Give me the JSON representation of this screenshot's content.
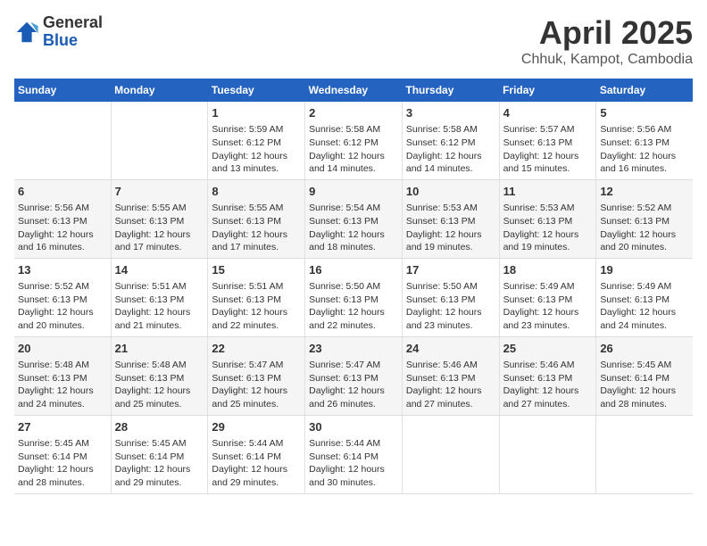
{
  "header": {
    "logo_general": "General",
    "logo_blue": "Blue",
    "main_title": "April 2025",
    "subtitle": "Chhuk, Kampot, Cambodia"
  },
  "days_of_week": [
    "Sunday",
    "Monday",
    "Tuesday",
    "Wednesday",
    "Thursday",
    "Friday",
    "Saturday"
  ],
  "weeks": [
    [
      {
        "day": "",
        "info": ""
      },
      {
        "day": "",
        "info": ""
      },
      {
        "day": "1",
        "info": "Sunrise: 5:59 AM\nSunset: 6:12 PM\nDaylight: 12 hours\nand 13 minutes."
      },
      {
        "day": "2",
        "info": "Sunrise: 5:58 AM\nSunset: 6:12 PM\nDaylight: 12 hours\nand 14 minutes."
      },
      {
        "day": "3",
        "info": "Sunrise: 5:58 AM\nSunset: 6:12 PM\nDaylight: 12 hours\nand 14 minutes."
      },
      {
        "day": "4",
        "info": "Sunrise: 5:57 AM\nSunset: 6:13 PM\nDaylight: 12 hours\nand 15 minutes."
      },
      {
        "day": "5",
        "info": "Sunrise: 5:56 AM\nSunset: 6:13 PM\nDaylight: 12 hours\nand 16 minutes."
      }
    ],
    [
      {
        "day": "6",
        "info": "Sunrise: 5:56 AM\nSunset: 6:13 PM\nDaylight: 12 hours\nand 16 minutes."
      },
      {
        "day": "7",
        "info": "Sunrise: 5:55 AM\nSunset: 6:13 PM\nDaylight: 12 hours\nand 17 minutes."
      },
      {
        "day": "8",
        "info": "Sunrise: 5:55 AM\nSunset: 6:13 PM\nDaylight: 12 hours\nand 17 minutes."
      },
      {
        "day": "9",
        "info": "Sunrise: 5:54 AM\nSunset: 6:13 PM\nDaylight: 12 hours\nand 18 minutes."
      },
      {
        "day": "10",
        "info": "Sunrise: 5:53 AM\nSunset: 6:13 PM\nDaylight: 12 hours\nand 19 minutes."
      },
      {
        "day": "11",
        "info": "Sunrise: 5:53 AM\nSunset: 6:13 PM\nDaylight: 12 hours\nand 19 minutes."
      },
      {
        "day": "12",
        "info": "Sunrise: 5:52 AM\nSunset: 6:13 PM\nDaylight: 12 hours\nand 20 minutes."
      }
    ],
    [
      {
        "day": "13",
        "info": "Sunrise: 5:52 AM\nSunset: 6:13 PM\nDaylight: 12 hours\nand 20 minutes."
      },
      {
        "day": "14",
        "info": "Sunrise: 5:51 AM\nSunset: 6:13 PM\nDaylight: 12 hours\nand 21 minutes."
      },
      {
        "day": "15",
        "info": "Sunrise: 5:51 AM\nSunset: 6:13 PM\nDaylight: 12 hours\nand 22 minutes."
      },
      {
        "day": "16",
        "info": "Sunrise: 5:50 AM\nSunset: 6:13 PM\nDaylight: 12 hours\nand 22 minutes."
      },
      {
        "day": "17",
        "info": "Sunrise: 5:50 AM\nSunset: 6:13 PM\nDaylight: 12 hours\nand 23 minutes."
      },
      {
        "day": "18",
        "info": "Sunrise: 5:49 AM\nSunset: 6:13 PM\nDaylight: 12 hours\nand 23 minutes."
      },
      {
        "day": "19",
        "info": "Sunrise: 5:49 AM\nSunset: 6:13 PM\nDaylight: 12 hours\nand 24 minutes."
      }
    ],
    [
      {
        "day": "20",
        "info": "Sunrise: 5:48 AM\nSunset: 6:13 PM\nDaylight: 12 hours\nand 24 minutes."
      },
      {
        "day": "21",
        "info": "Sunrise: 5:48 AM\nSunset: 6:13 PM\nDaylight: 12 hours\nand 25 minutes."
      },
      {
        "day": "22",
        "info": "Sunrise: 5:47 AM\nSunset: 6:13 PM\nDaylight: 12 hours\nand 25 minutes."
      },
      {
        "day": "23",
        "info": "Sunrise: 5:47 AM\nSunset: 6:13 PM\nDaylight: 12 hours\nand 26 minutes."
      },
      {
        "day": "24",
        "info": "Sunrise: 5:46 AM\nSunset: 6:13 PM\nDaylight: 12 hours\nand 27 minutes."
      },
      {
        "day": "25",
        "info": "Sunrise: 5:46 AM\nSunset: 6:13 PM\nDaylight: 12 hours\nand 27 minutes."
      },
      {
        "day": "26",
        "info": "Sunrise: 5:45 AM\nSunset: 6:14 PM\nDaylight: 12 hours\nand 28 minutes."
      }
    ],
    [
      {
        "day": "27",
        "info": "Sunrise: 5:45 AM\nSunset: 6:14 PM\nDaylight: 12 hours\nand 28 minutes."
      },
      {
        "day": "28",
        "info": "Sunrise: 5:45 AM\nSunset: 6:14 PM\nDaylight: 12 hours\nand 29 minutes."
      },
      {
        "day": "29",
        "info": "Sunrise: 5:44 AM\nSunset: 6:14 PM\nDaylight: 12 hours\nand 29 minutes."
      },
      {
        "day": "30",
        "info": "Sunrise: 5:44 AM\nSunset: 6:14 PM\nDaylight: 12 hours\nand 30 minutes."
      },
      {
        "day": "",
        "info": ""
      },
      {
        "day": "",
        "info": ""
      },
      {
        "day": "",
        "info": ""
      }
    ]
  ]
}
